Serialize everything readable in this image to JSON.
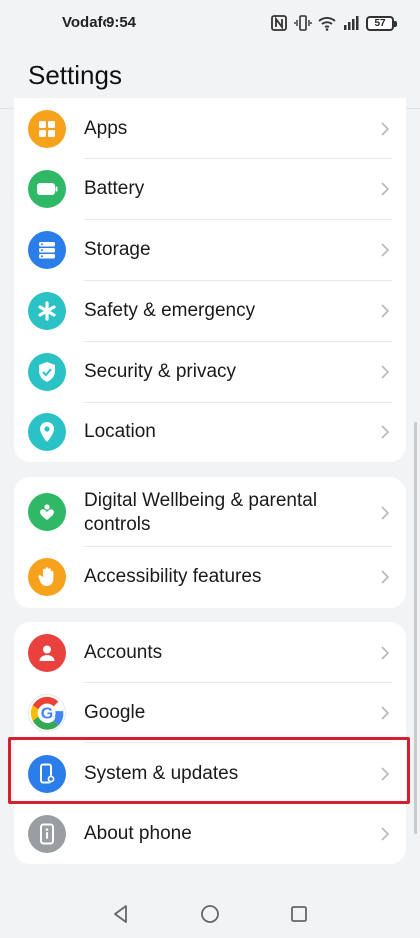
{
  "status_bar": {
    "carrier": "Vodafone",
    "time": "9:54",
    "battery": "57"
  },
  "page": {
    "title": "Settings"
  },
  "groups": [
    {
      "items": [
        {
          "label": "Apps",
          "icon": "apps-icon",
          "color": "#f7a21c"
        },
        {
          "label": "Battery",
          "icon": "battery-icon",
          "color": "#2fb865"
        },
        {
          "label": "Storage",
          "icon": "storage-icon",
          "color": "#2b7de9"
        },
        {
          "label": "Safety & emergency",
          "icon": "asterisk-icon",
          "color": "#2bc2c6"
        },
        {
          "label": "Security & privacy",
          "icon": "shield-icon",
          "color": "#2bc2c6"
        },
        {
          "label": "Location",
          "icon": "location-pin-icon",
          "color": "#2bc2c6"
        }
      ]
    },
    {
      "items": [
        {
          "label_line1": "Digital Wellbeing & parental",
          "label_line2": "controls",
          "icon": "wellbeing-icon",
          "color": "#2fb865"
        },
        {
          "label": "Accessibility features",
          "icon": "hand-icon",
          "color": "#f7a21c"
        }
      ]
    },
    {
      "items": [
        {
          "label": "Accounts",
          "icon": "account-icon",
          "color": "#e8413e"
        },
        {
          "label": "Google",
          "icon": "google-icon",
          "color": "#ffffff"
        },
        {
          "label": "System & updates",
          "icon": "system-phone-icon",
          "color": "#2b7de9"
        },
        {
          "label": "About phone",
          "icon": "info-icon",
          "color": "#9a9da1"
        }
      ]
    }
  ],
  "highlight": {
    "target": "System & updates",
    "color": "#d61f2c"
  }
}
